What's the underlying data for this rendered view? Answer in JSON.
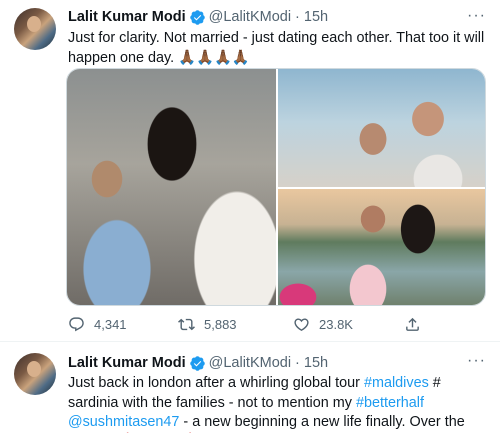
{
  "tweets": [
    {
      "author": {
        "name": "Lalit Kumar Modi",
        "handle": "@LalitKModi"
      },
      "dot": "·",
      "time": "15h",
      "text": "Just for clarity. Not married - just dating each other. That too it will happen one day.",
      "text_emojis": "🙏🏾🙏🏾🙏🏾🙏🏾",
      "media": [
        "photo",
        "photo",
        "photo"
      ],
      "stats": {
        "replies": "4,341",
        "retweets": "5,883",
        "likes": "23.8K"
      }
    },
    {
      "author": {
        "name": "Lalit Kumar Modi",
        "handle": "@LalitKModi"
      },
      "dot": "·",
      "time": "15h",
      "text_parts": [
        "Just back in london after a whirling global tour ",
        "#maldives",
        " # sardinia with the families - not to mention my ",
        "#betterhalf",
        " ",
        "@sushmitasen47",
        " - a new beginning a new life finally. Over the moon. ",
        "🥰😘😍😍🥰💕💕💖💕❤️"
      ]
    }
  ],
  "icons": {
    "verified": "verified-badge-icon",
    "more": "more-horizontal-icon",
    "reply": "reply-icon",
    "retweet": "retweet-icon",
    "like": "heart-icon",
    "share": "share-icon"
  },
  "colors": {
    "link": "#1d9bf0",
    "verified": "#1d9bf0",
    "secondary_text": "#536471"
  }
}
